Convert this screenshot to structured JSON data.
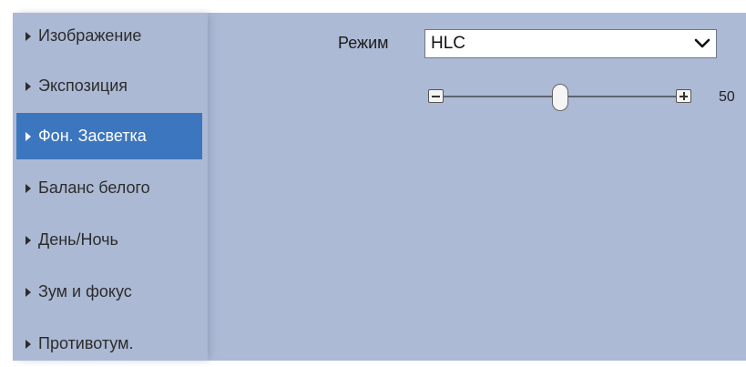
{
  "sidebar": {
    "items": [
      {
        "label": "Изображение"
      },
      {
        "label": "Экспозиция"
      },
      {
        "label": "Фон. Засветка",
        "active": true
      },
      {
        "label": "Баланс белого"
      },
      {
        "label": "День/Ночь"
      },
      {
        "label": "Зум и фокус"
      },
      {
        "label": "Противотум."
      }
    ]
  },
  "mode": {
    "label": "Режим",
    "selected": "HLC"
  },
  "slider": {
    "value": "50",
    "min": 0,
    "max": 100
  },
  "colors": {
    "background": "#adbad5",
    "active_item": "#3c76be",
    "active_text": "#ffffff"
  },
  "icons": {
    "nav_arrow": "triangle-right-icon",
    "dropdown": "chevron-down-icon",
    "decrease": "minus-icon",
    "increase": "plus-icon"
  }
}
